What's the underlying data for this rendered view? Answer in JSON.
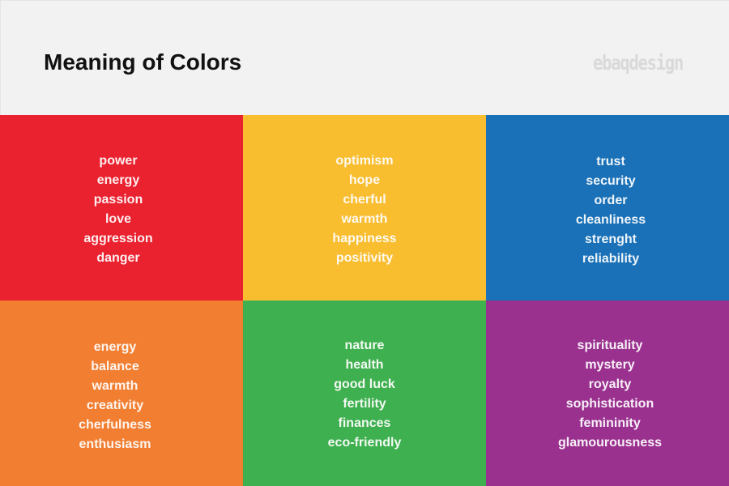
{
  "header": {
    "title": "Meaning of Colors",
    "logo": "ebaqdesign"
  },
  "colors": [
    {
      "name": "red",
      "hex": "#ea212f",
      "meanings": [
        "power",
        "energy",
        "passion",
        "love",
        "aggression",
        "danger"
      ]
    },
    {
      "name": "yellow",
      "hex": "#f9bd30",
      "meanings": [
        "optimism",
        "hope",
        "cherful",
        "warmth",
        "happiness",
        "positivity"
      ]
    },
    {
      "name": "blue",
      "hex": "#1a71b7",
      "meanings": [
        "trust",
        "security",
        "order",
        "cleanliness",
        "strenght",
        "reliability"
      ]
    },
    {
      "name": "orange",
      "hex": "#f17e31",
      "meanings": [
        "energy",
        "balance",
        "warmth",
        "creativity",
        "cherfulness",
        "enthusiasm"
      ]
    },
    {
      "name": "green",
      "hex": "#3fb04f",
      "meanings": [
        "nature",
        "health",
        "good luck",
        "fertility",
        "finances",
        "eco-friendly"
      ]
    },
    {
      "name": "purple",
      "hex": "#9a318f",
      "meanings": [
        "spirituality",
        "mystery",
        "royalty",
        "sophistication",
        "femininity",
        "glamourousness"
      ]
    }
  ]
}
